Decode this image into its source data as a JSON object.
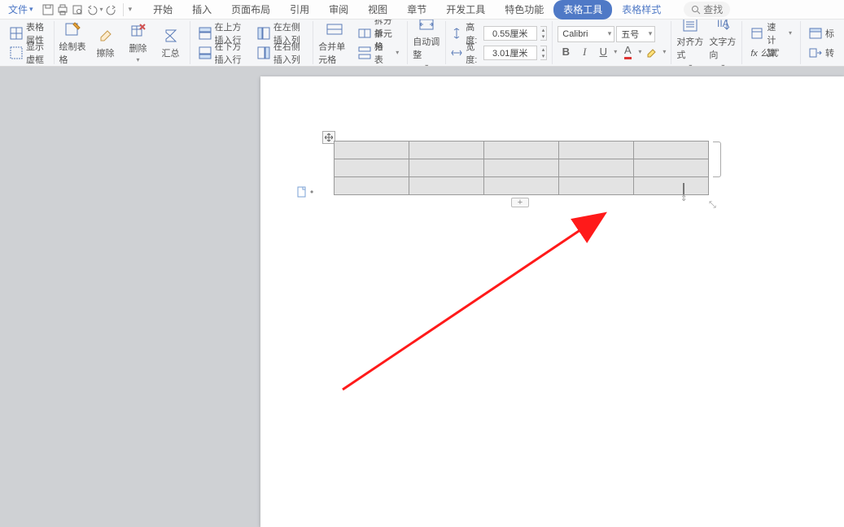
{
  "menubar": {
    "file": "文件",
    "tabs": [
      "开始",
      "插入",
      "页面布局",
      "引用",
      "审阅",
      "视图",
      "章节",
      "开发工具",
      "特色功能",
      "表格工具",
      "表格样式"
    ],
    "active_tab_index": 9,
    "search": "查找"
  },
  "ribbon": {
    "g1": {
      "btn1": "显示虚框",
      "btn2": "表格属性"
    },
    "g2": {
      "draw": "绘制表格",
      "eraser": "擦除",
      "del": "删除",
      "sum": "汇总"
    },
    "g3": {
      "r1": "在上方插入行",
      "r2": "在下方插入行",
      "r3": "在左侧插入列",
      "r4": "在右侧插入列"
    },
    "g4": {
      "merge": "合并单元格",
      "split": "拆分单元格",
      "split_table": "拆分表格"
    },
    "g5": {
      "auto": "自动调整"
    },
    "g6": {
      "h_label": "高度:",
      "h_val": "0.55厘米",
      "w_label": "宽度:",
      "w_val": "3.01厘米"
    },
    "g7": {
      "font": "Calibri",
      "size": "五号"
    },
    "g8": {
      "align": "对齐方式",
      "dir": "文字方向"
    },
    "g9": {
      "calc": "快速计算",
      "formula": "fx 公式"
    },
    "g10": {
      "conv": "转",
      "title": "标"
    }
  }
}
